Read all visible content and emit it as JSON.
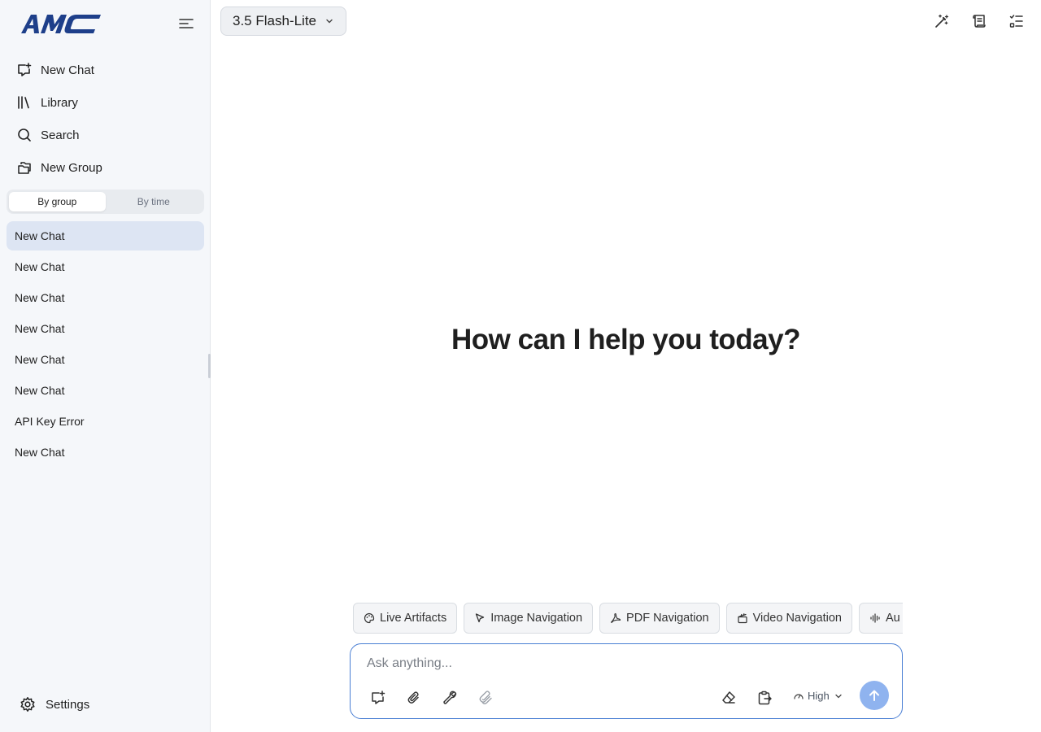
{
  "app": {
    "logo_text": "AMC",
    "accent_color": "#1e3f8a",
    "selected_color": "#dde5f3"
  },
  "sidebar": {
    "nav": [
      {
        "label": "New Chat",
        "icon": "new-chat-icon"
      },
      {
        "label": "Library",
        "icon": "library-icon"
      },
      {
        "label": "Search",
        "icon": "search-icon"
      },
      {
        "label": "New Group",
        "icon": "folder-icon"
      }
    ],
    "view_toggle": {
      "by_group": "By group",
      "by_time": "By time",
      "active": "By group"
    },
    "chats": [
      "New Chat",
      "New Chat",
      "New Chat",
      "New Chat",
      "New Chat",
      "New Chat",
      "API Key Error",
      "New Chat"
    ],
    "active_chat_index": 0,
    "settings_label": "Settings"
  },
  "header": {
    "model": "3.5 Flash-Lite",
    "icons": [
      "magic-wand-icon",
      "scroll-icon",
      "task-list-icon"
    ]
  },
  "main": {
    "greeting": "How can I help you today?"
  },
  "chips": [
    {
      "label": "Live Artifacts",
      "icon": "palette-icon"
    },
    {
      "label": "Image Navigation",
      "icon": "cursor-icon"
    },
    {
      "label": "PDF Navigation",
      "icon": "pdf-icon"
    },
    {
      "label": "Video Navigation",
      "icon": "clapperboard-icon"
    },
    {
      "label": "Au",
      "icon": "audio-wave-icon"
    }
  ],
  "composer": {
    "placeholder": "Ask anything...",
    "effort": "High",
    "send_color": "#8fb3ef"
  }
}
